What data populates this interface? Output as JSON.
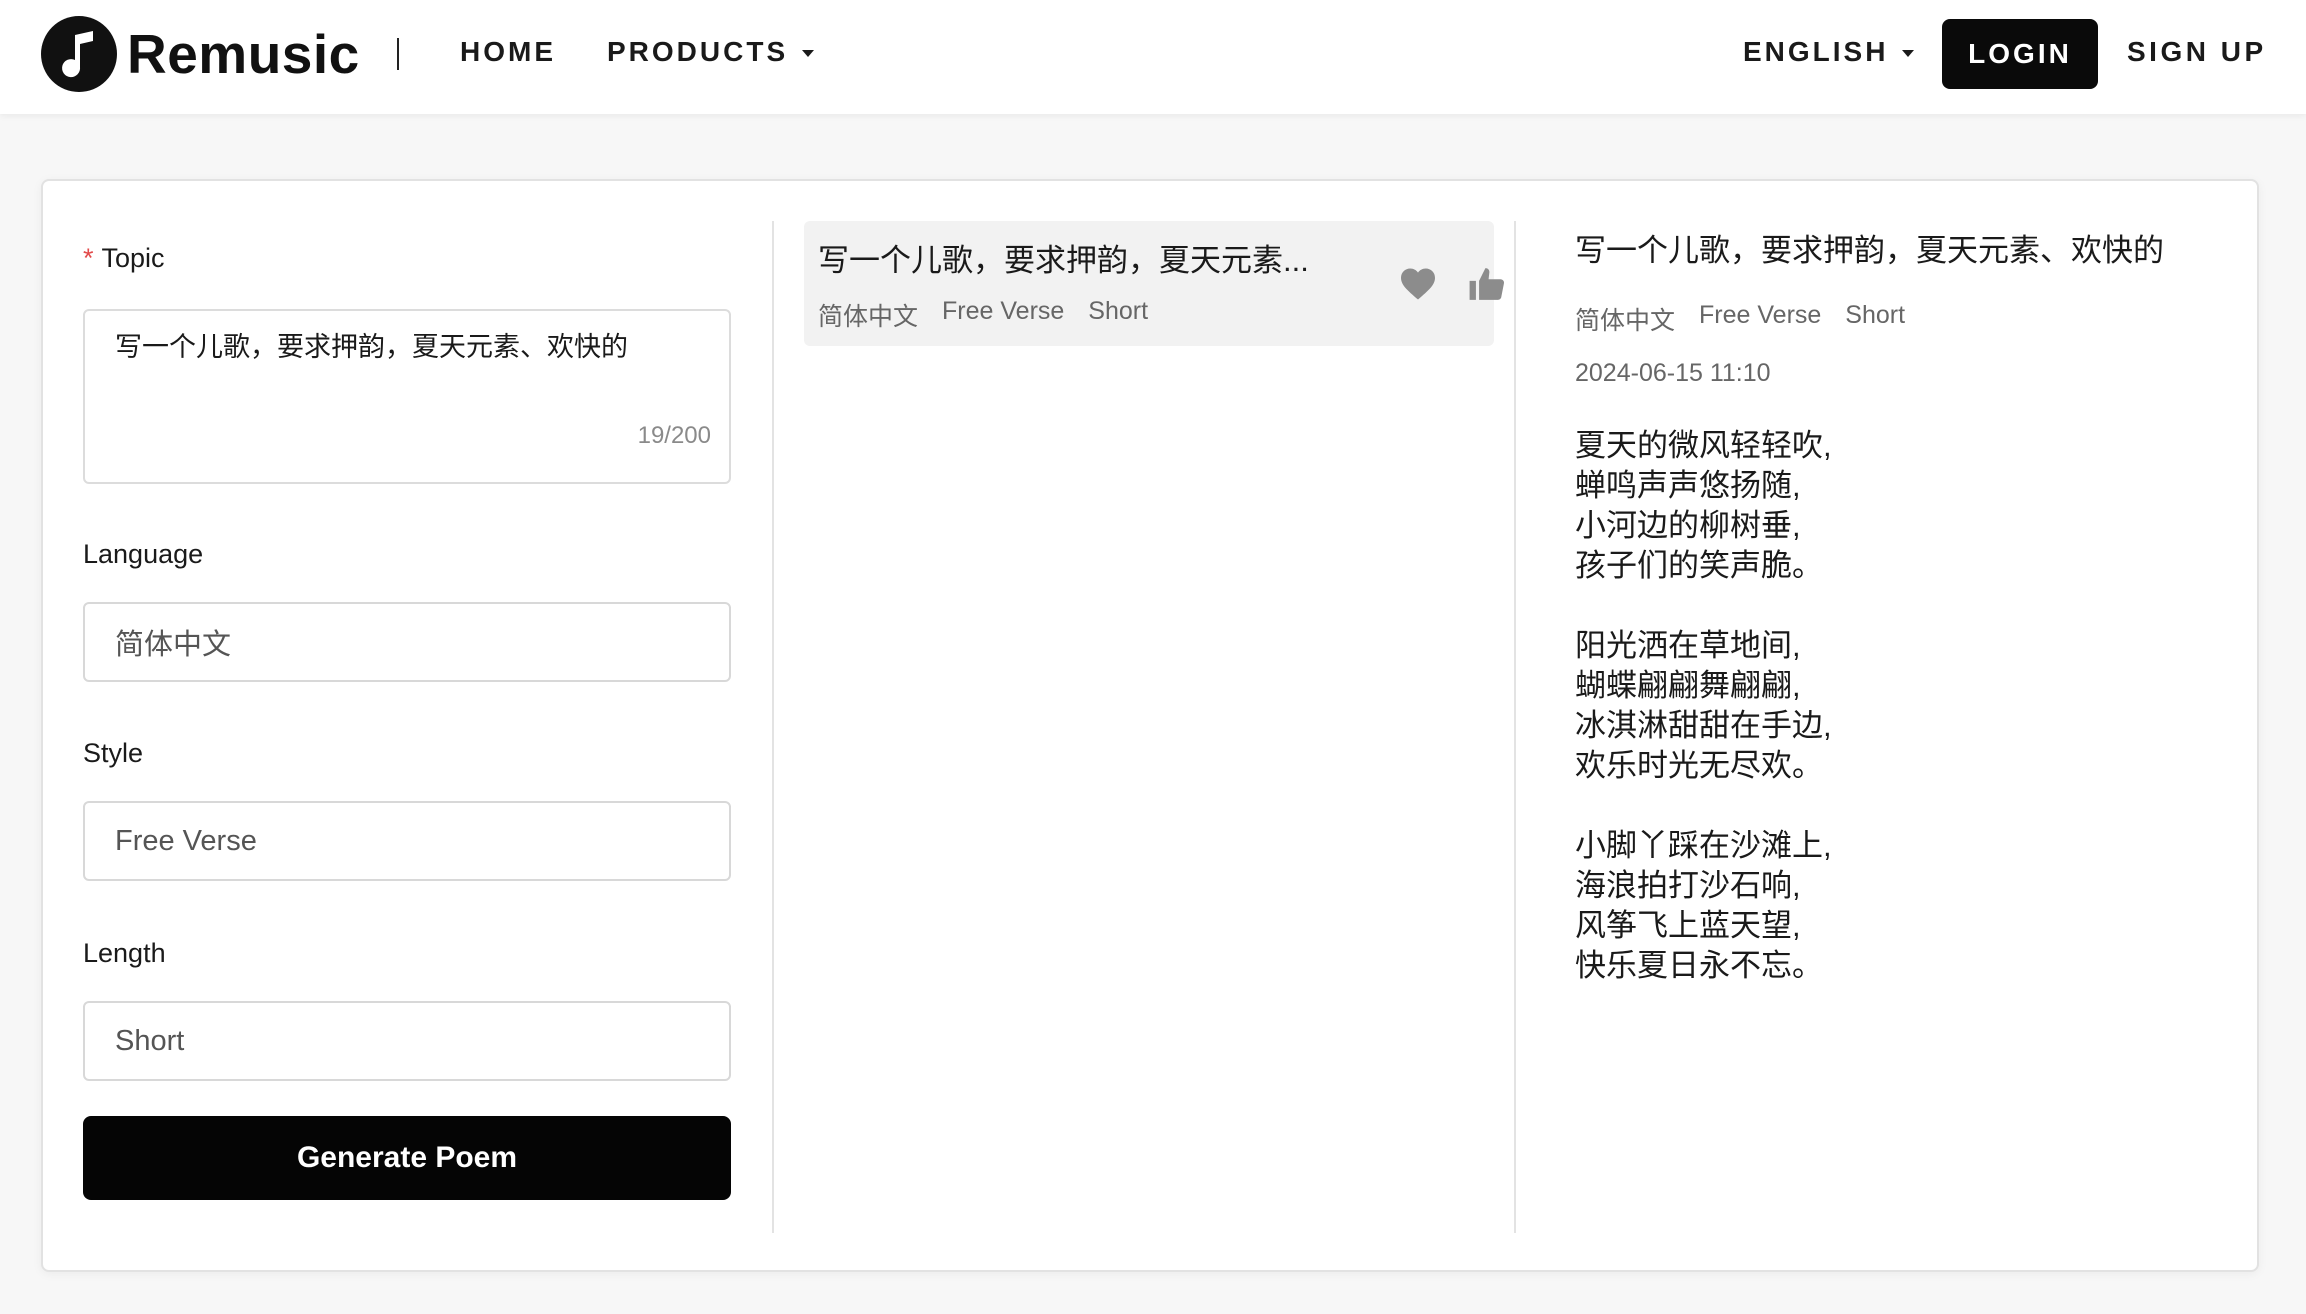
{
  "header": {
    "logo_text": "Remusic",
    "nav": {
      "home": "HOME",
      "products": "PRODUCTS",
      "language": "ENGLISH"
    },
    "login": "LOGIN",
    "signup": "SIGN UP"
  },
  "form": {
    "topic_required_mark": "*",
    "topic_label": "Topic",
    "topic_value": "写一个儿歌，要求押韵，夏天元素、欢快的",
    "topic_counter": "19/200",
    "language_label": "Language",
    "language_value": "简体中文",
    "style_label": "Style",
    "style_value": "Free Verse",
    "length_label": "Length",
    "length_value": "Short",
    "generate_button": "Generate Poem"
  },
  "history": [
    {
      "title": "写一个儿歌，要求押韵，夏天元素...",
      "tags": [
        "简体中文",
        "Free Verse",
        "Short"
      ]
    }
  ],
  "result": {
    "title": "写一个儿歌，要求押韵，夏天元素、欢快的",
    "tags": [
      "简体中文",
      "Free Verse",
      "Short"
    ],
    "date": "2024-06-15 11:10",
    "poem": " 夏天的微风轻轻吹,\n蝉鸣声声悠扬随,\n小河边的柳树垂,\n孩子们的笑声脆。\n\n阳光洒在草地间,\n蝴蝶翩翩舞翩翩,\n冰淇淋甜甜在手边,\n欢乐时光无尽欢。\n\n小脚丫踩在沙滩上,\n海浪拍打沙石响,\n风筝飞上蓝天望,\n快乐夏日永不忘。"
  },
  "colors": {
    "accent": "#0a0a0a",
    "required": "#e24b4b",
    "history_bg": "#f2f2f2",
    "icon": "#8c8c8c"
  },
  "icons": {
    "logo": "music-note-icon",
    "favorite": "heart-icon",
    "like": "thumbs-up-icon"
  }
}
